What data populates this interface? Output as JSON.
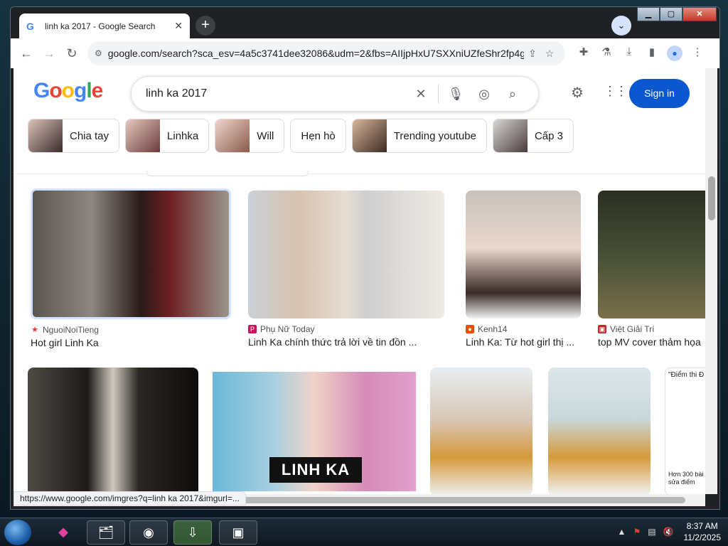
{
  "browser": {
    "tab_title": "linh ka 2017 - Google Search",
    "url": "google.com/search?sca_esv=4a5c3741dee32086&udm=2&fbs=AIIjpHxU7SXXniUZfeShr2fp4g...",
    "status_url": "https://www.google.com/imgres?q=linh ka 2017&imgurl=..."
  },
  "google": {
    "logo_letters": [
      "G",
      "o",
      "o",
      "g",
      "l",
      "e"
    ],
    "query": "linh ka 2017",
    "signin_label": "Sign in"
  },
  "chips": [
    {
      "label": "Chia tay",
      "thumb": true
    },
    {
      "label": "Linhka",
      "thumb": true
    },
    {
      "label": "Will",
      "thumb": true
    },
    {
      "label": "Hẹn hò",
      "thumb": false
    },
    {
      "label": "Trending youtube",
      "thumb": true
    },
    {
      "label": "Cấp 3",
      "thumb": true
    }
  ],
  "results_row1": [
    {
      "source": "NguoiNoiTieng",
      "title": "Hot girl Linh Ka",
      "source_color": "#e53935"
    },
    {
      "source": "Phụ Nữ Today",
      "title": "Linh Ka chính thức trả lời về tin đồn ...",
      "source_color": "#c2185b"
    },
    {
      "source": "Kenh14",
      "title": "Linh Ka: Từ hot girl thị ...",
      "source_color": "#e65100"
    },
    {
      "source": "Việt Giải Trí",
      "title": "top MV cover thảm họa",
      "source_color": "#c62828"
    }
  ],
  "results_row2": {
    "banner_text": "LINH KA",
    "partial_heading": "\"Điểm thi Đ",
    "partial_caption_1": "Hơn 300 bài",
    "partial_caption_2": "sửa điểm"
  },
  "taskbar": {
    "time": "8:37 AM",
    "date": "11/2/2025"
  }
}
